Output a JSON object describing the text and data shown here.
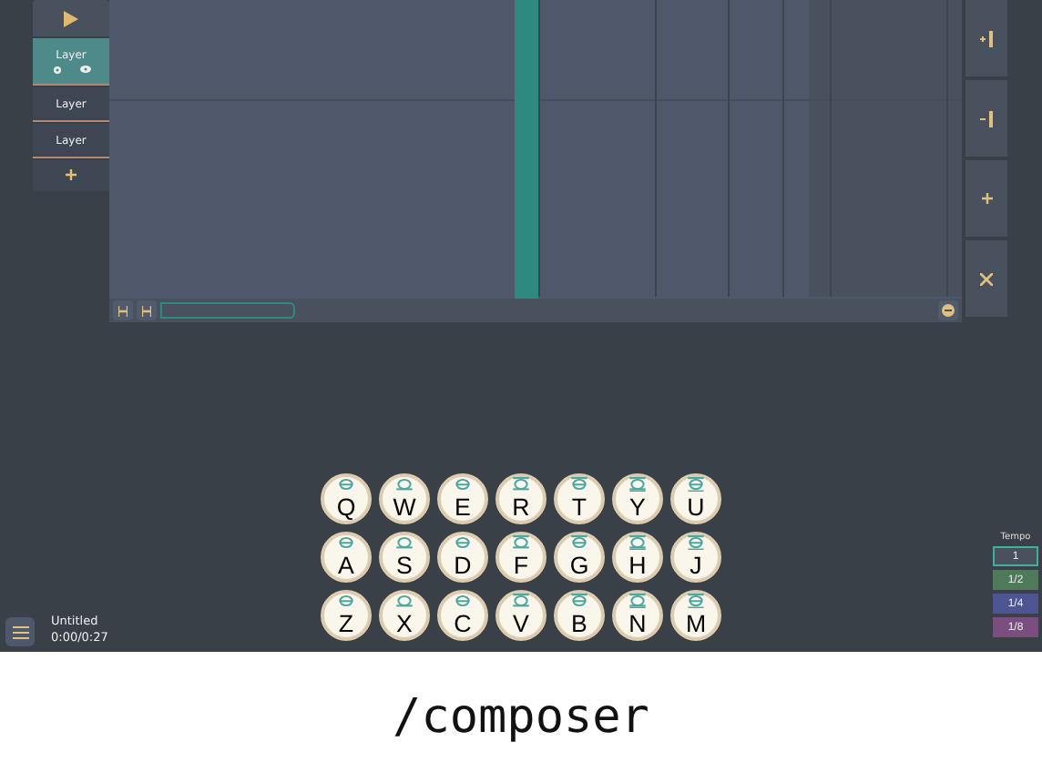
{
  "tracks": [
    {
      "label": "Layer",
      "selected": true
    },
    {
      "label": "Layer",
      "selected": false
    },
    {
      "label": "Layer",
      "selected": false
    }
  ],
  "timeline": {
    "playhead": {
      "level": 0.49
    }
  },
  "keys": [
    {
      "label": "Q"
    },
    {
      "label": "W"
    },
    {
      "label": "E"
    },
    {
      "label": "R"
    },
    {
      "label": "T"
    },
    {
      "label": "Y"
    },
    {
      "label": "U"
    },
    {
      "label": "A"
    },
    {
      "label": "S"
    },
    {
      "label": "D"
    },
    {
      "label": "F"
    },
    {
      "label": "G"
    },
    {
      "label": "H"
    },
    {
      "label": "J"
    },
    {
      "label": "Z"
    },
    {
      "label": "X"
    },
    {
      "label": "C"
    },
    {
      "label": "V"
    },
    {
      "label": "B"
    },
    {
      "label": "N"
    },
    {
      "label": "M"
    }
  ],
  "song": {
    "title": "Untitled",
    "time": "0:00/0:27"
  },
  "tempo": {
    "label": "Tempo",
    "options": [
      {
        "label": "1",
        "color": "#49515e",
        "selected": true
      },
      {
        "label": "1/2",
        "color": "#4f7a5a",
        "selected": false
      },
      {
        "label": "1/4",
        "color": "#4f5592",
        "selected": false
      },
      {
        "label": "1/8",
        "color": "#7a4f80",
        "selected": false
      }
    ]
  },
  "caption": "/composer"
}
